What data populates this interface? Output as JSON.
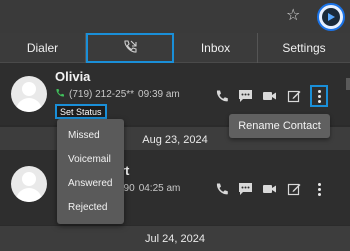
{
  "browser": {
    "star_icon": "star-outline-icon",
    "extension_icon": "play-circle-icon"
  },
  "tabs": [
    {
      "label": "Dialer"
    },
    {
      "label": "",
      "icon": "call-log-icon",
      "active": true
    },
    {
      "label": "Inbox"
    },
    {
      "label": "Settings"
    }
  ],
  "calls": [
    {
      "name": "Olivia",
      "number": "(719) 212-25**",
      "time": "09:39 am",
      "status_button": "Set Status"
    },
    {
      "name": "rt",
      "number": "590",
      "time": "04:25 am"
    }
  ],
  "dates": [
    "Aug 23, 2024",
    "Jul 24, 2024"
  ],
  "status_menu": {
    "options": [
      "Missed",
      "Voicemail",
      "Answered",
      "Rejected"
    ]
  },
  "context_menu": {
    "rename_label": "Rename Contact"
  },
  "colors": {
    "accent": "#1a8fd8",
    "phone_green": "#3fbf5a",
    "background": "#2b2b2b"
  }
}
